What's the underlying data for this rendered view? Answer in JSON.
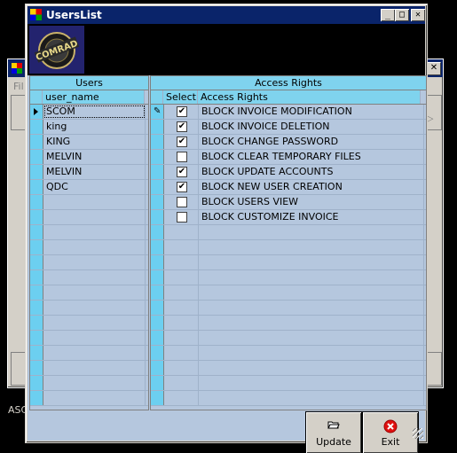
{
  "background_window": {
    "menu_text": "Fil",
    "status_text": "ASC",
    "close_glyph": "✕",
    "scroll_hint": "▷"
  },
  "window": {
    "title": "UsersList",
    "minimize_glyph": "_",
    "maximize_glyph": "□",
    "close_glyph": "✕"
  },
  "logo": {
    "text": "COMRAD",
    "icon": "company-logo"
  },
  "users_grid": {
    "caption": "Users",
    "column": "user_name",
    "rows": [
      "SCOM",
      "king",
      "KING",
      "MELVIN",
      "MELVIN",
      "QDC"
    ],
    "empty_row_count": 14,
    "current_row_index": 0
  },
  "rights_grid": {
    "caption": "Access Rights",
    "columns": [
      "Select",
      "Access Rights"
    ],
    "rows": [
      {
        "checked": true,
        "label": "BLOCK INVOICE MODIFICATION"
      },
      {
        "checked": true,
        "label": "BLOCK INVOICE DELETION"
      },
      {
        "checked": true,
        "label": "BLOCK CHANGE PASSWORD"
      },
      {
        "checked": false,
        "label": "BLOCK CLEAR TEMPORARY FILES"
      },
      {
        "checked": true,
        "label": "BLOCK UPDATE ACCOUNTS"
      },
      {
        "checked": true,
        "label": "BLOCK NEW USER CREATION"
      },
      {
        "checked": false,
        "label": "BLOCK USERS VIEW"
      },
      {
        "checked": false,
        "label": "BLOCK CUSTOMIZE INVOICE"
      }
    ],
    "empty_row_count": 12
  },
  "buttons": {
    "update_label": "Update",
    "exit_label": "Exit"
  },
  "colors": {
    "header_cyan": "#7fd3ee",
    "grid_body": "#b5c7de",
    "titlebar": "#0a246a"
  }
}
